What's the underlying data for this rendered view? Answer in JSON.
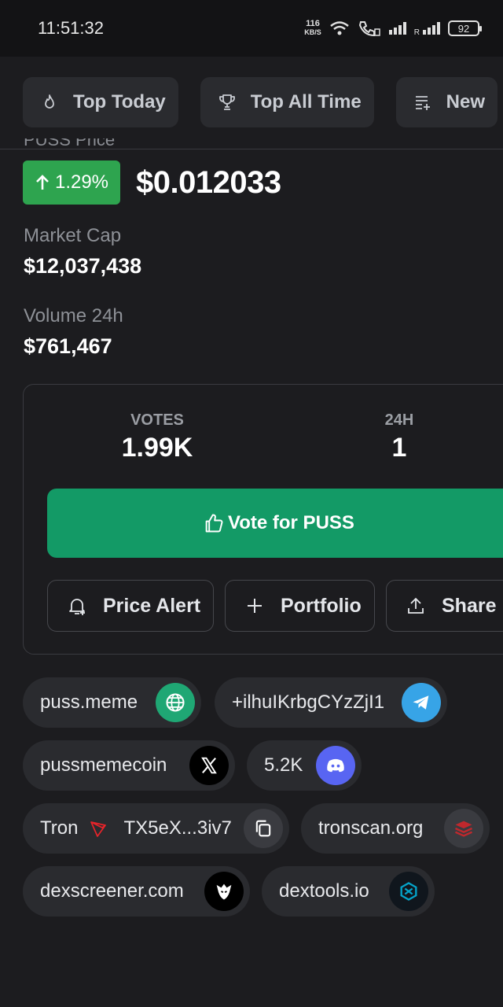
{
  "status_bar": {
    "time": "11:51:32",
    "net_speed_value": "116",
    "net_speed_unit": "KB/S",
    "sim_label": "R",
    "battery": "92"
  },
  "filters": [
    {
      "label": "Top Today",
      "icon": "flame-icon"
    },
    {
      "label": "Top All Time",
      "icon": "trophy-icon"
    },
    {
      "label": "New",
      "icon": "list-add-icon"
    }
  ],
  "coin": {
    "price_label_partial": "PUSS Price",
    "change": "1.29%",
    "change_direction": "up",
    "price": "$0.012033",
    "market_cap_label": "Market Cap",
    "market_cap": "$12,037,438",
    "volume_label": "Volume 24h",
    "volume": "$761,467"
  },
  "votes": {
    "votes_label": "VOTES",
    "votes_value": "1.99K",
    "h24_label": "24H",
    "h24_value": "1",
    "vote_button": "Vote for PUSS",
    "price_alert": "Price Alert",
    "portfolio": "Portfolio",
    "share": "Share"
  },
  "links": {
    "website": "puss.meme",
    "telegram": "+ilhuIKrbgCYzZjI1",
    "twitter": "pussmemecoin",
    "discord": "5.2K",
    "chain": "Tron",
    "contract": "TX5eX...3iv7",
    "tronscan": "tronscan.org",
    "dexscreener": "dexscreener.com",
    "dextools": "dextools.io"
  },
  "colors": {
    "background": "#1c1c1f",
    "positive": "#2ea44f",
    "vote_button": "#139a66",
    "chip_bg": "#2a2b2f"
  }
}
